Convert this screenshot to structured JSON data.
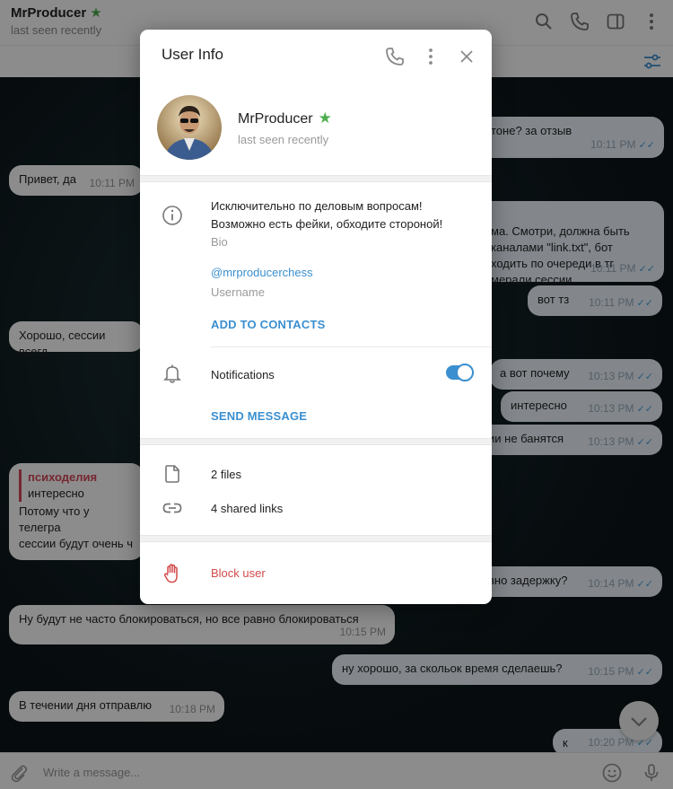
{
  "header": {
    "title": "MrProducer",
    "status": "last seen recently"
  },
  "messages": [
    {
      "text": "тоне? за отзыв",
      "time": "10:11 PM"
    },
    {
      "text": "Привет, да",
      "time": "10:11 PM"
    },
    {
      "text": "ма. Смотри, должна быть\nканалами \"link.txt\", бот\nходить по очереди в тг\nмерали сессии",
      "time": "10:11 PM"
    },
    {
      "text": "вот тз",
      "time": "10:11 PM"
    },
    {
      "text": "Хорошо, сессии всегд",
      "time": ""
    },
    {
      "text": "а вот почему",
      "time": "10:13 PM"
    },
    {
      "text": "интересно",
      "time": "10:13 PM"
    },
    {
      "text": "ии не банятся",
      "time": "10:13 PM"
    },
    {
      "reply_author": "психоделия",
      "reply_text": "интересно",
      "text": "Потому что у телегра\nсессии будут очень ч"
    },
    {
      "text": "вно задержку?",
      "time": "10:14 PM"
    },
    {
      "text": "Ну будут не часто блокироваться, но все равно блокироваться",
      "time": "10:15 PM"
    },
    {
      "text": "ну хорошо, за скольок время сделаешь?",
      "time": "10:15 PM"
    },
    {
      "text": "В течении дня отправлю",
      "time": "10:18 PM"
    },
    {
      "text": "к",
      "time": "10:20 PM"
    }
  ],
  "composer": {
    "placeholder": "Write a message..."
  },
  "modal": {
    "title": "User Info",
    "name": "MrProducer",
    "status": "last seen recently",
    "bio": "Исключительно по деловым вопросам!\nВозможно есть фейки, обходите стороной!",
    "bio_caption": "Bio",
    "username": "@mrproducerchess",
    "username_caption": "Username",
    "add_contacts": "ADD TO CONTACTS",
    "notifications": "Notifications",
    "notifications_on": true,
    "send_message": "SEND MESSAGE",
    "files": "2 files",
    "links": "4 shared links",
    "block": "Block user"
  },
  "colors": {
    "accent": "#3a8fd0",
    "verified_star": "#4fae4e",
    "danger": "#d24a4a",
    "reply_accent": "#d8485a"
  },
  "icons": [
    "search-icon",
    "phone-icon",
    "sidebar-icon",
    "more-icon",
    "filter-icon",
    "info-icon",
    "bell-icon",
    "file-icon",
    "link-icon",
    "hand-icon",
    "close-icon",
    "chevron-down-icon",
    "attach-icon",
    "emoji-icon",
    "mic-icon"
  ]
}
